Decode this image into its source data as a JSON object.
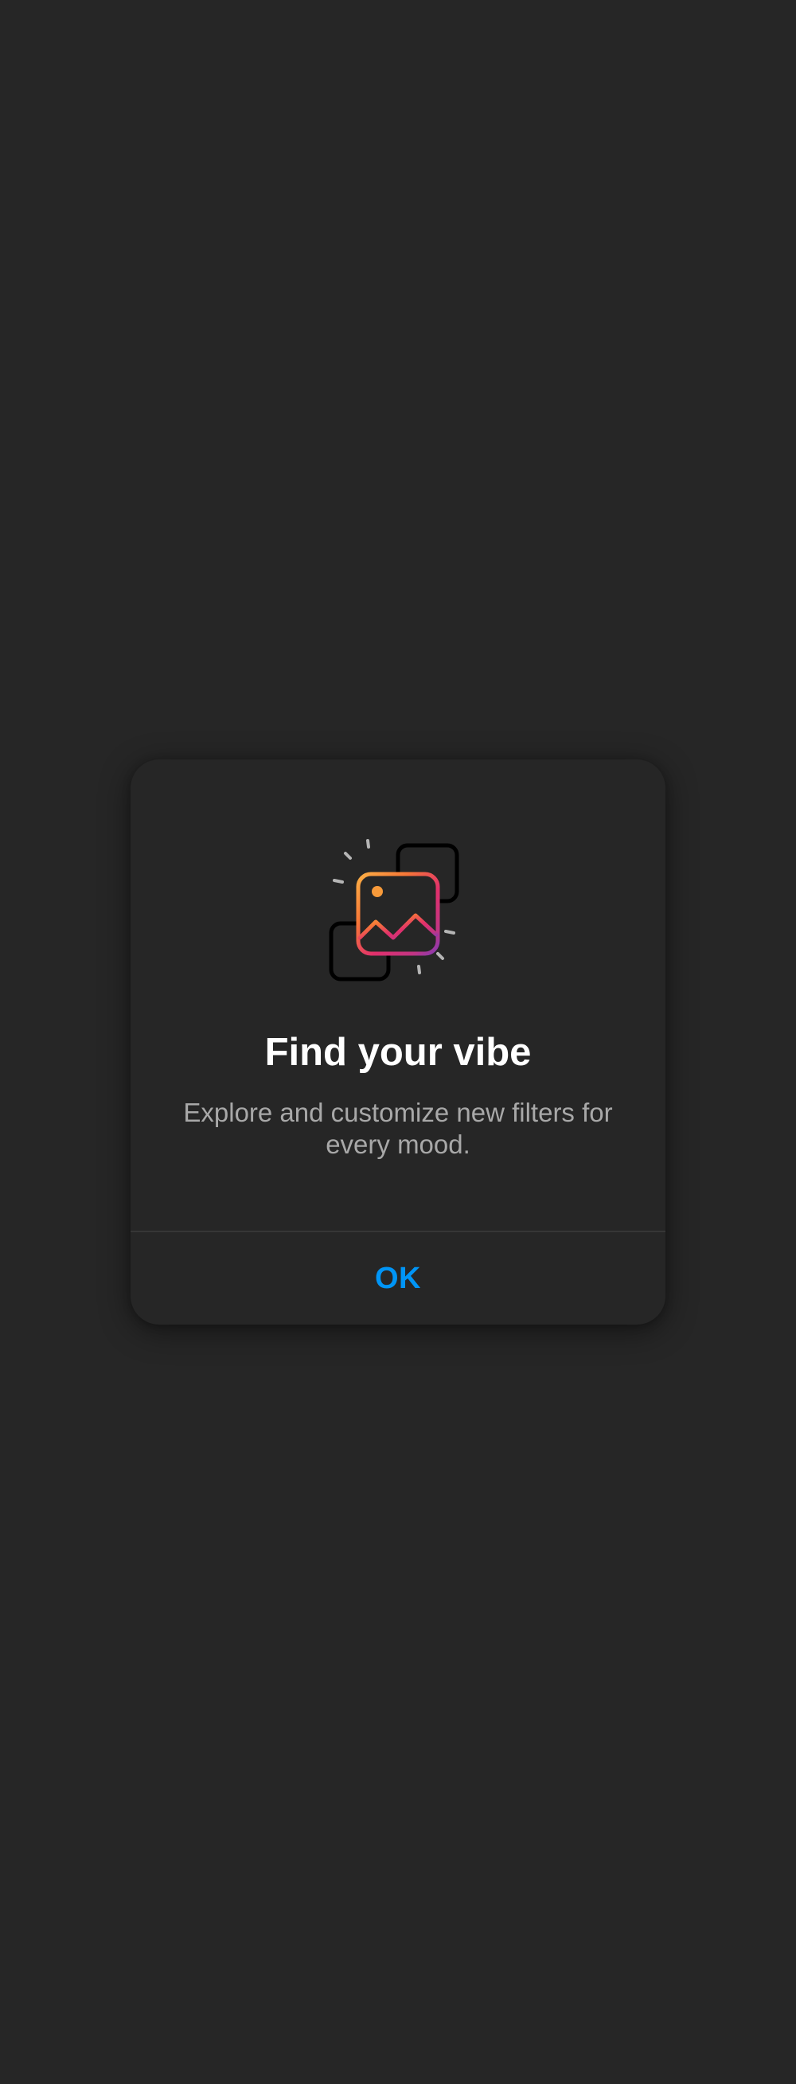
{
  "dialog": {
    "title": "Find your vibe",
    "message": "Explore and customize new filters for every mood.",
    "ok_label": "OK",
    "illustration_icon": "filters-photo-icon"
  },
  "colors": {
    "background": "#262626",
    "dialog_background": "#262626",
    "title": "#ffffff",
    "message": "#a8a8a8",
    "action": "#0095f6",
    "divider": "#363636",
    "gradient": [
      "#fcaf45",
      "#f77737",
      "#e1306c",
      "#c13584",
      "#833ab4"
    ]
  }
}
